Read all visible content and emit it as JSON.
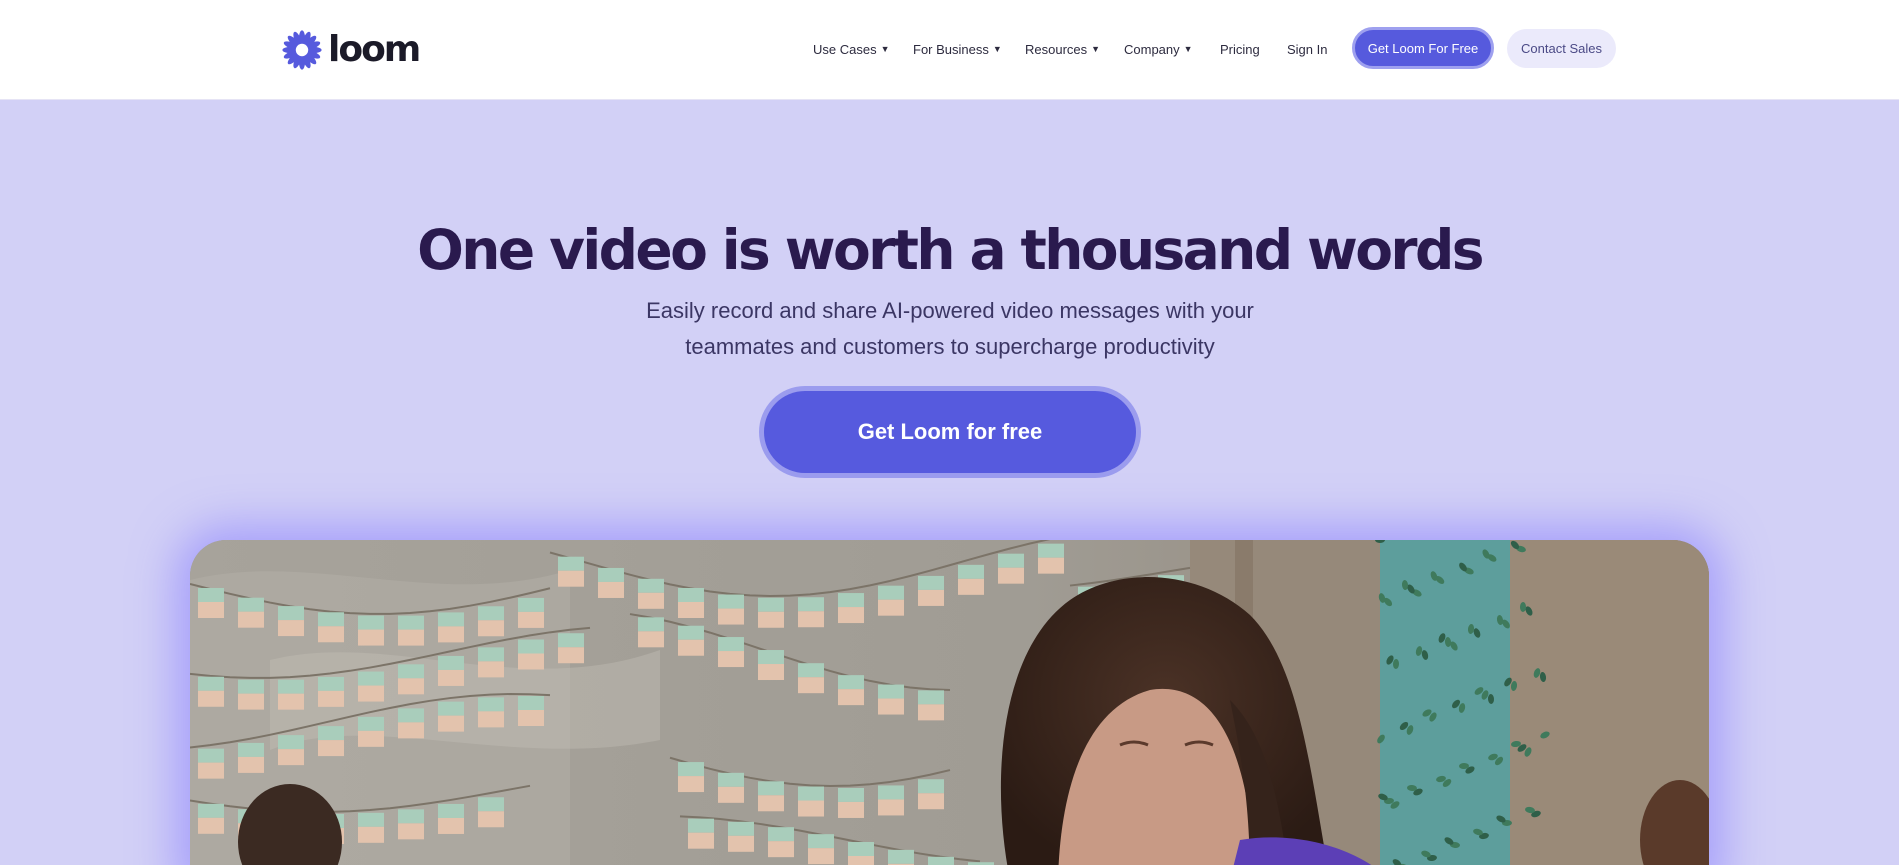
{
  "brand": {
    "name": "loom",
    "accent_color": "#565ADD",
    "hero_background": "#D2D0F6"
  },
  "nav": {
    "items": [
      {
        "label": "Use Cases",
        "has_dropdown": true
      },
      {
        "label": "For Business",
        "has_dropdown": true
      },
      {
        "label": "Resources",
        "has_dropdown": true
      },
      {
        "label": "Company",
        "has_dropdown": true
      },
      {
        "label": "Pricing",
        "has_dropdown": false
      },
      {
        "label": "Sign In",
        "has_dropdown": false
      }
    ],
    "cta_label": "Get Loom For Free",
    "sales_label": "Contact Sales",
    "dropdown_icon": "caret-down-icon"
  },
  "hero": {
    "title": "One video is worth a thousand words",
    "subtitle_line1": "Easily record and share AI-powered video messages with your",
    "subtitle_line2": "teammates and customers to supercharge productivity",
    "cta_label": "Get Loom for free"
  },
  "media": {
    "kind": "video"
  }
}
